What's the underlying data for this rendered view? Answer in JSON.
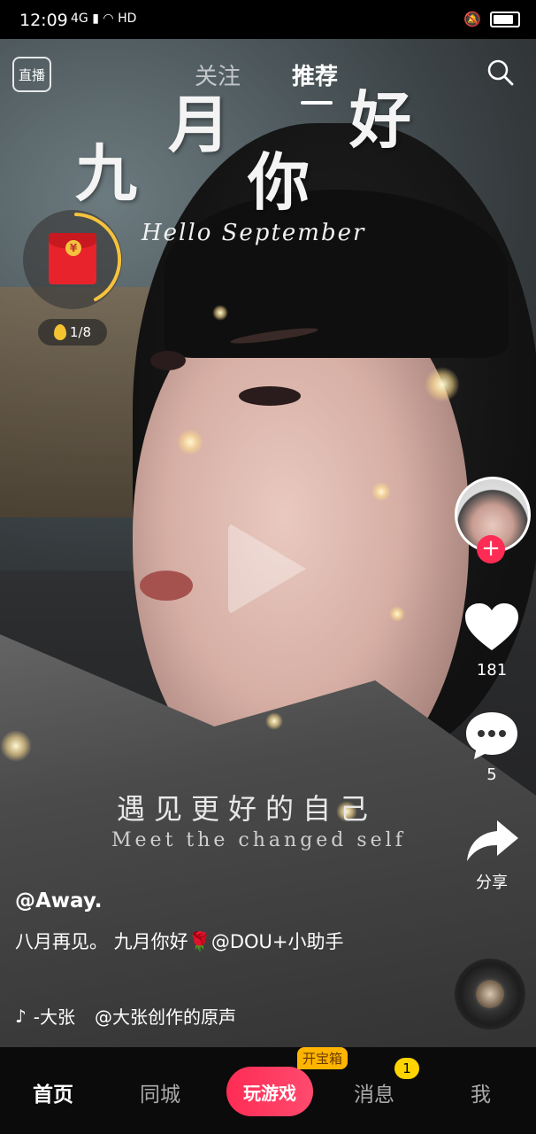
{
  "status_bar": {
    "time": "12:09",
    "network": "4G",
    "hd_label": "HD"
  },
  "top_nav": {
    "live_label": "直播",
    "tabs": [
      {
        "label": "关注",
        "active": false
      },
      {
        "label": "推荐",
        "active": true
      }
    ],
    "search_icon": "search-icon"
  },
  "video_overlay": {
    "calligraphy": [
      "九",
      "月",
      "你",
      "好"
    ],
    "hello_text": "Hello September",
    "subtitle_cn": "遇见更好的自己",
    "subtitle_en": "Meet the changed self"
  },
  "red_packet": {
    "coin_symbol": "¥",
    "progress_text": "1/8"
  },
  "right_rail": {
    "like_count": "181",
    "comment_count": "5",
    "share_label": "分享",
    "follow_symbol": "+"
  },
  "post": {
    "author": "@Away.",
    "caption": "八月再见。          九月你好🌹@DOU+小助手",
    "music_prefix": "-大张",
    "music_text": "@大张创作的原声"
  },
  "bottom_nav": {
    "items": [
      "首页",
      "同城",
      "消息",
      "我"
    ],
    "game_label": "玩游戏",
    "treasure_badge": "开宝箱",
    "message_badge": "1"
  },
  "colors": {
    "accent_red": "#fe2c55",
    "badge_yellow": "#ffd400",
    "treasure_orange": "#ffb400"
  }
}
